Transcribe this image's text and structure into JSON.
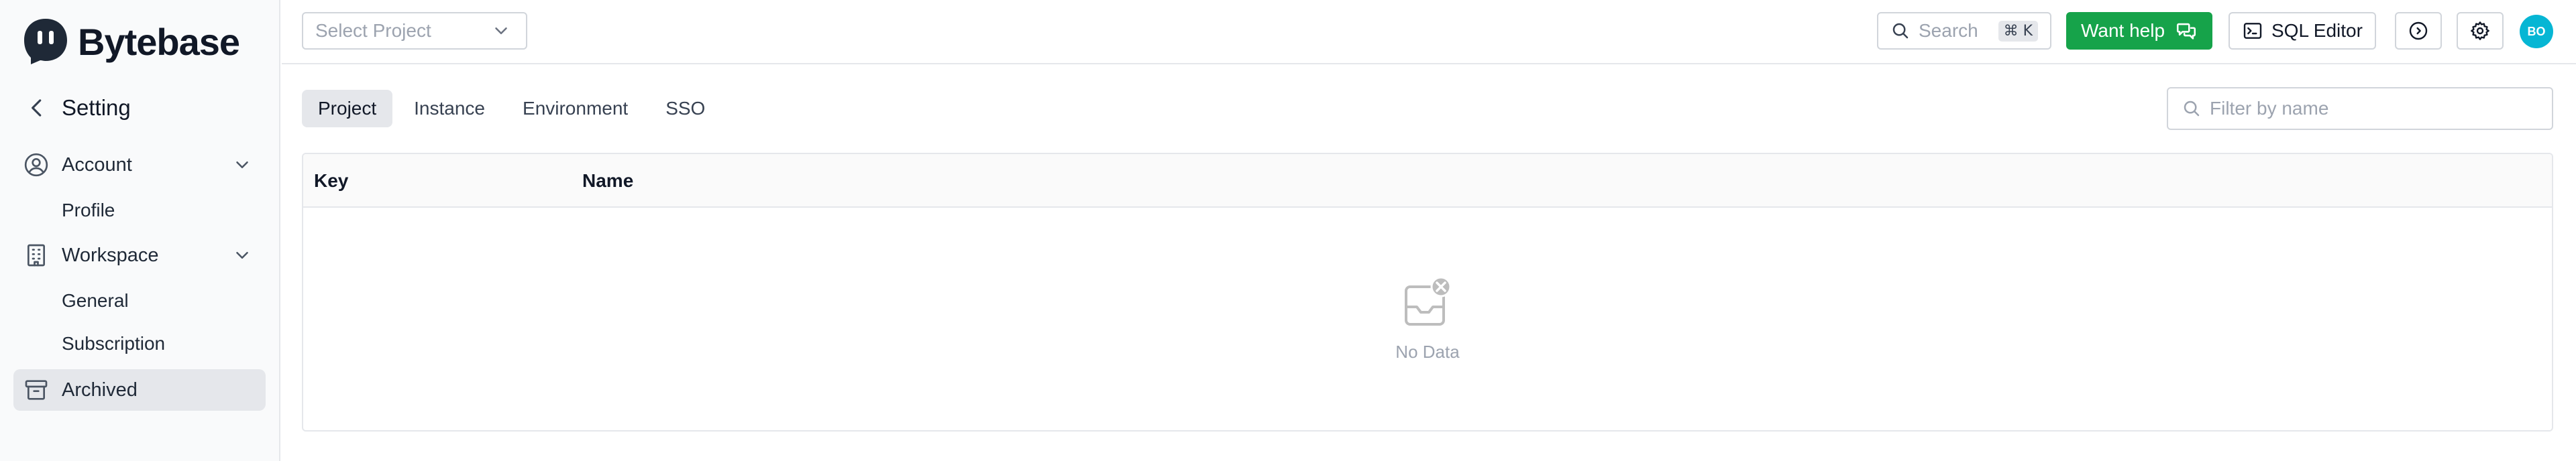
{
  "brand": {
    "name": "Bytebase"
  },
  "sidebar": {
    "back_label": "Setting",
    "sections": [
      {
        "label": "Account",
        "icon": "user-circle-icon",
        "items": [
          "Profile"
        ]
      },
      {
        "label": "Workspace",
        "icon": "building-icon",
        "items": [
          "General",
          "Subscription"
        ]
      }
    ],
    "archived_label": "Archived"
  },
  "header": {
    "project_placeholder": "Select Project",
    "search_label": "Search",
    "search_shortcut": "⌘ K",
    "help_label": "Want help",
    "sql_editor_label": "SQL Editor",
    "avatar_initials": "BO"
  },
  "main": {
    "tabs": [
      {
        "label": "Project",
        "active": true
      },
      {
        "label": "Instance",
        "active": false
      },
      {
        "label": "Environment",
        "active": false
      },
      {
        "label": "SSO",
        "active": false
      }
    ],
    "filter_placeholder": "Filter by name",
    "table": {
      "columns": [
        "Key",
        "Name"
      ],
      "empty_text": "No Data"
    }
  },
  "colors": {
    "accent_green": "#16a34a",
    "avatar_bg": "#06b6d4",
    "sidebar_active": "#e5e7eb"
  }
}
